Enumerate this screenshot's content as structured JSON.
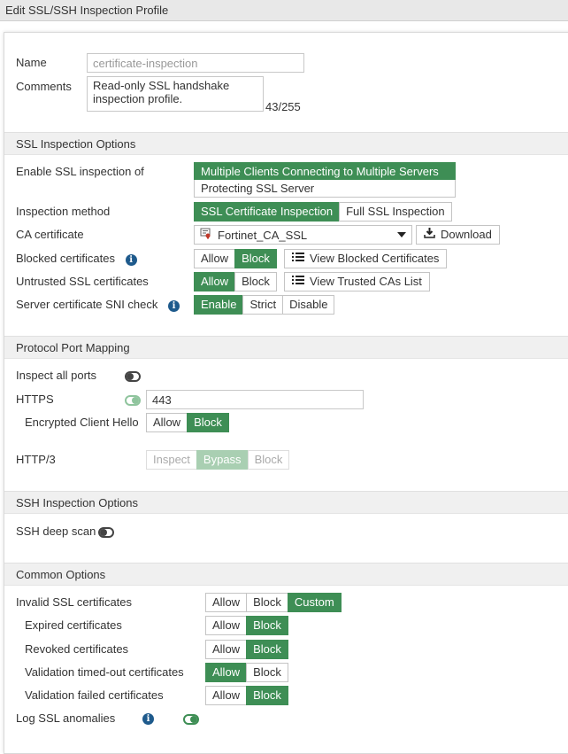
{
  "window": {
    "title": "Edit SSL/SSH Inspection Profile"
  },
  "general": {
    "name_label": "Name",
    "name_value": "certificate-inspection",
    "comments_label": "Comments",
    "comments_value": "Read-only SSL handshake\ninspection profile.",
    "comments_counter": "43/255"
  },
  "ssl_section": {
    "title": "SSL Inspection Options",
    "enable_label": "Enable SSL inspection of",
    "enable_options": [
      "Multiple Clients Connecting to Multiple Servers",
      "Protecting SSL Server"
    ],
    "enable_selected": "Multiple Clients Connecting to Multiple Servers",
    "method_label": "Inspection method",
    "method_options": [
      "SSL Certificate Inspection",
      "Full SSL Inspection"
    ],
    "method_selected": "SSL Certificate Inspection",
    "ca_label": "CA certificate",
    "ca_value": "Fortinet_CA_SSL",
    "download_label": "Download",
    "blocked_label": "Blocked certificates",
    "blocked_options": [
      "Allow",
      "Block"
    ],
    "blocked_selected": "Block",
    "view_blocked_label": "View Blocked Certificates",
    "untrusted_label": "Untrusted SSL certificates",
    "untrusted_options": [
      "Allow",
      "Block"
    ],
    "untrusted_selected": "Allow",
    "view_trusted_label": "View Trusted CAs List",
    "sni_label": "Server certificate SNI check",
    "sni_options": [
      "Enable",
      "Strict",
      "Disable"
    ],
    "sni_selected": "Enable"
  },
  "port_section": {
    "title": "Protocol Port Mapping",
    "inspect_all_label": "Inspect all ports",
    "inspect_all_on": false,
    "https_label": "HTTPS",
    "https_on": true,
    "https_port": "443",
    "ech_label": "Encrypted Client Hello",
    "ech_options": [
      "Allow",
      "Block"
    ],
    "ech_selected": "Block",
    "http3_label": "HTTP/3",
    "http3_options": [
      "Inspect",
      "Bypass",
      "Block"
    ],
    "http3_selected": "Bypass"
  },
  "ssh_section": {
    "title": "SSH Inspection Options",
    "deep_scan_label": "SSH deep scan",
    "deep_scan_on": false
  },
  "common_section": {
    "title": "Common Options",
    "invalid_label": "Invalid SSL certificates",
    "invalid_options": [
      "Allow",
      "Block",
      "Custom"
    ],
    "invalid_selected": "Custom",
    "expired_label": "Expired certificates",
    "expired_selected": "Block",
    "revoked_label": "Revoked certificates",
    "revoked_selected": "Block",
    "timeout_label": "Validation timed-out certificates",
    "timeout_selected": "Allow",
    "failed_label": "Validation failed certificates",
    "failed_selected": "Block",
    "allow_block_options": [
      "Allow",
      "Block"
    ],
    "log_label": "Log SSL anomalies",
    "log_on": true
  },
  "colors": {
    "accent": "#3e8e55",
    "info_icon": "#1e5a8c",
    "section_bg": "#f0f0f0"
  },
  "icons": {
    "info": "info-icon",
    "certificate": "certificate-icon",
    "download": "download-icon",
    "list": "list-icon"
  }
}
